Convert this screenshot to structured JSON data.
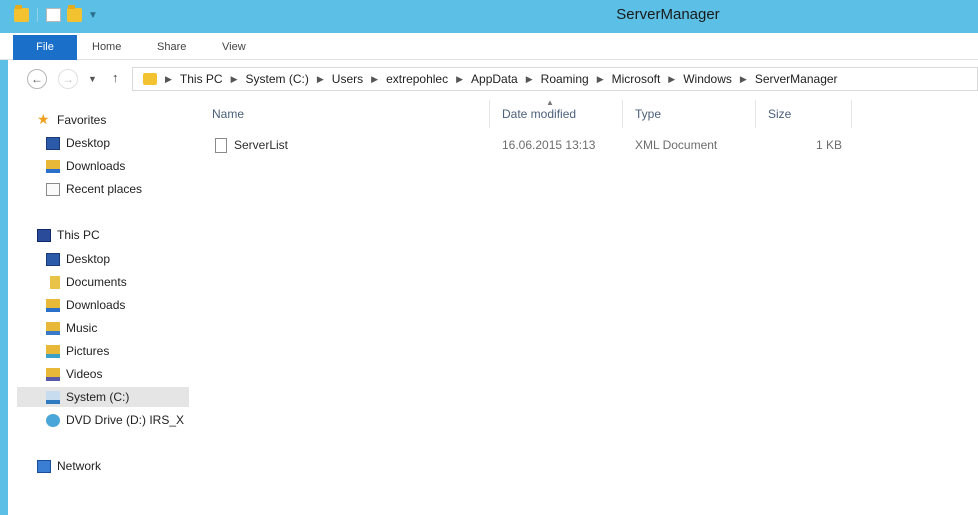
{
  "window": {
    "title": "ServerManager"
  },
  "ribbon": {
    "tabs": [
      "File",
      "Home",
      "Share",
      "View"
    ]
  },
  "address": {
    "crumbs": [
      "This PC",
      "System (C:)",
      "Users",
      "extrepohlec",
      "AppData",
      "Roaming",
      "Microsoft",
      "Windows",
      "ServerManager"
    ]
  },
  "navpane": {
    "favorites": {
      "label": "Favorites",
      "items": [
        "Desktop",
        "Downloads",
        "Recent places"
      ]
    },
    "thispc": {
      "label": "This PC",
      "items": [
        "Desktop",
        "Documents",
        "Downloads",
        "Music",
        "Pictures",
        "Videos",
        "System (C:)",
        "DVD Drive (D:) IRS_X"
      ]
    },
    "network": {
      "label": "Network"
    },
    "selected": "System (C:)"
  },
  "filelist": {
    "columns": [
      "Name",
      "Date modified",
      "Type",
      "Size"
    ],
    "rows": [
      {
        "name": "ServerList",
        "date_modified": "16.06.2015 13:13",
        "type": "XML Document",
        "size": "1 KB"
      }
    ]
  },
  "colors": {
    "titlebar": "#5cc0e6",
    "file_tab": "#1a6fc9"
  }
}
